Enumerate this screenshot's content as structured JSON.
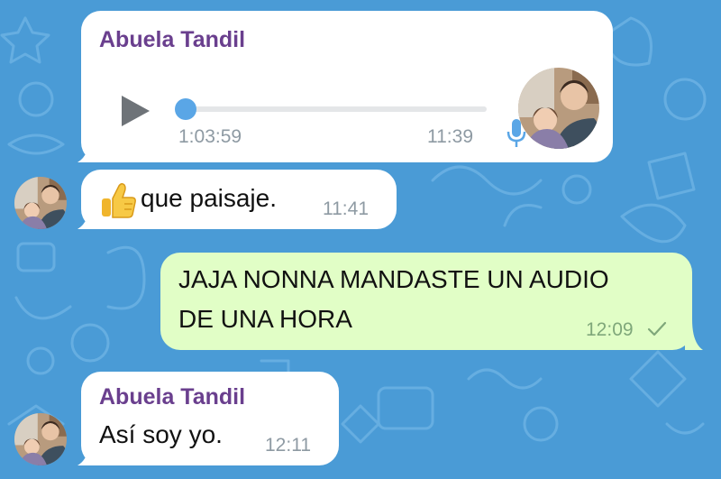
{
  "colors": {
    "wallpaper": "#4a9bd6",
    "incoming_bubble": "#ffffff",
    "outgoing_bubble": "#e1fec6",
    "sender_name": "#6a3f8e",
    "accent": "#5aa6e6"
  },
  "messages": [
    {
      "direction": "incoming",
      "type": "voice",
      "sender": "Abuela Tandil",
      "duration": "1:03:59",
      "playback_progress": 0.0,
      "time": "11:39",
      "icons": [
        "play-icon",
        "microphone-icon"
      ],
      "has_avatar": true
    },
    {
      "direction": "incoming",
      "type": "text",
      "emoji": "thumbs-up-icon",
      "text": "que paisaje.",
      "time": "11:41",
      "has_avatar": true
    },
    {
      "direction": "outgoing",
      "type": "text",
      "text_line_1": "JAJA NONNA MANDASTE UN AUDIO",
      "text_line_2": "DE UNA HORA",
      "time": "12:09",
      "status_icon": "check-icon"
    },
    {
      "direction": "incoming",
      "type": "text",
      "sender": "Abuela Tandil",
      "text": "Así soy yo.",
      "time": "12:11",
      "has_avatar": true
    }
  ]
}
